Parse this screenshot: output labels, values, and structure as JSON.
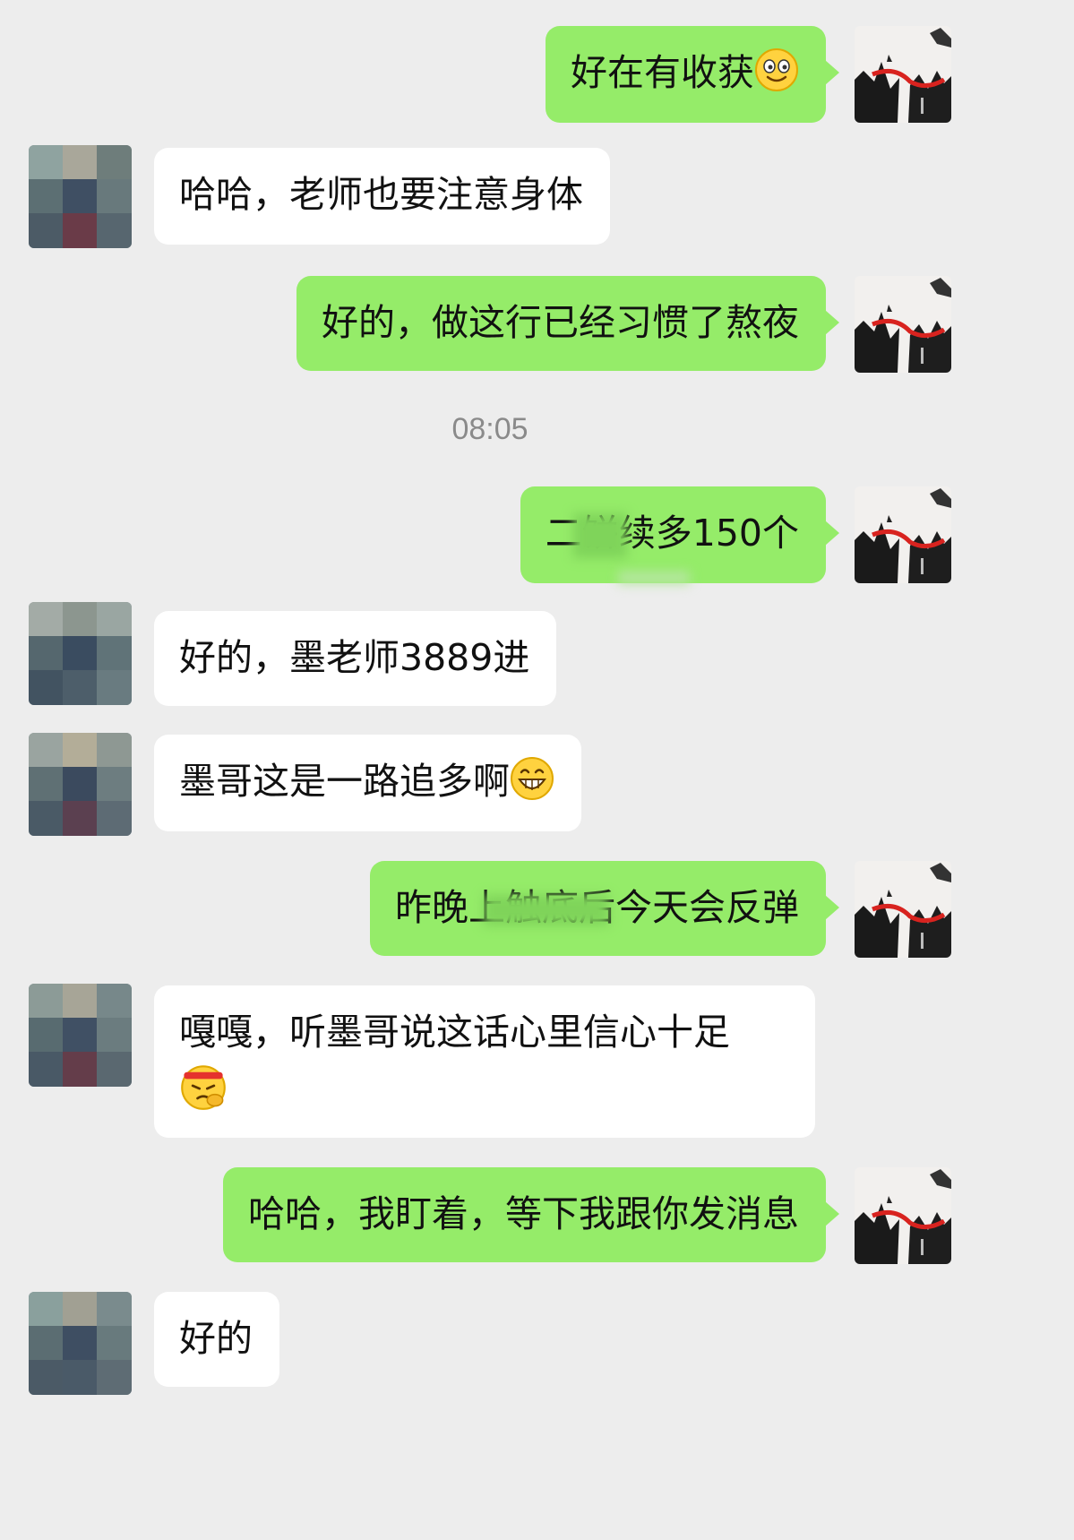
{
  "colors": {
    "background": "#ededed",
    "my_bubble": "#95ec69",
    "their_bubble": "#ffffff",
    "timestamp": "#8a8a8a"
  },
  "messages": [
    {
      "side": "me",
      "text": "好在有收获",
      "emoji": "smile-emoji"
    },
    {
      "side": "other",
      "text": "哈哈，老师也要注意身体"
    },
    {
      "side": "me",
      "text": "好的，做这行已经习惯了熬夜"
    },
    {
      "type": "timestamp",
      "text": "08:05"
    },
    {
      "side": "me",
      "text": "二饼续多150个"
    },
    {
      "side": "other",
      "text": "好的，墨老师3889进"
    },
    {
      "side": "other",
      "text": "墨哥这是一路追多啊",
      "emoji": "grin-emoji"
    },
    {
      "side": "me",
      "text": "昨晚上触底后今天会反弹"
    },
    {
      "side": "other",
      "text": "嘎嘎，听墨哥说这话心里信心十足",
      "emoji": "determined-emoji"
    },
    {
      "side": "me",
      "text": "哈哈，我盯着，等下我跟你发消息"
    },
    {
      "side": "other",
      "text": "好的"
    }
  ]
}
